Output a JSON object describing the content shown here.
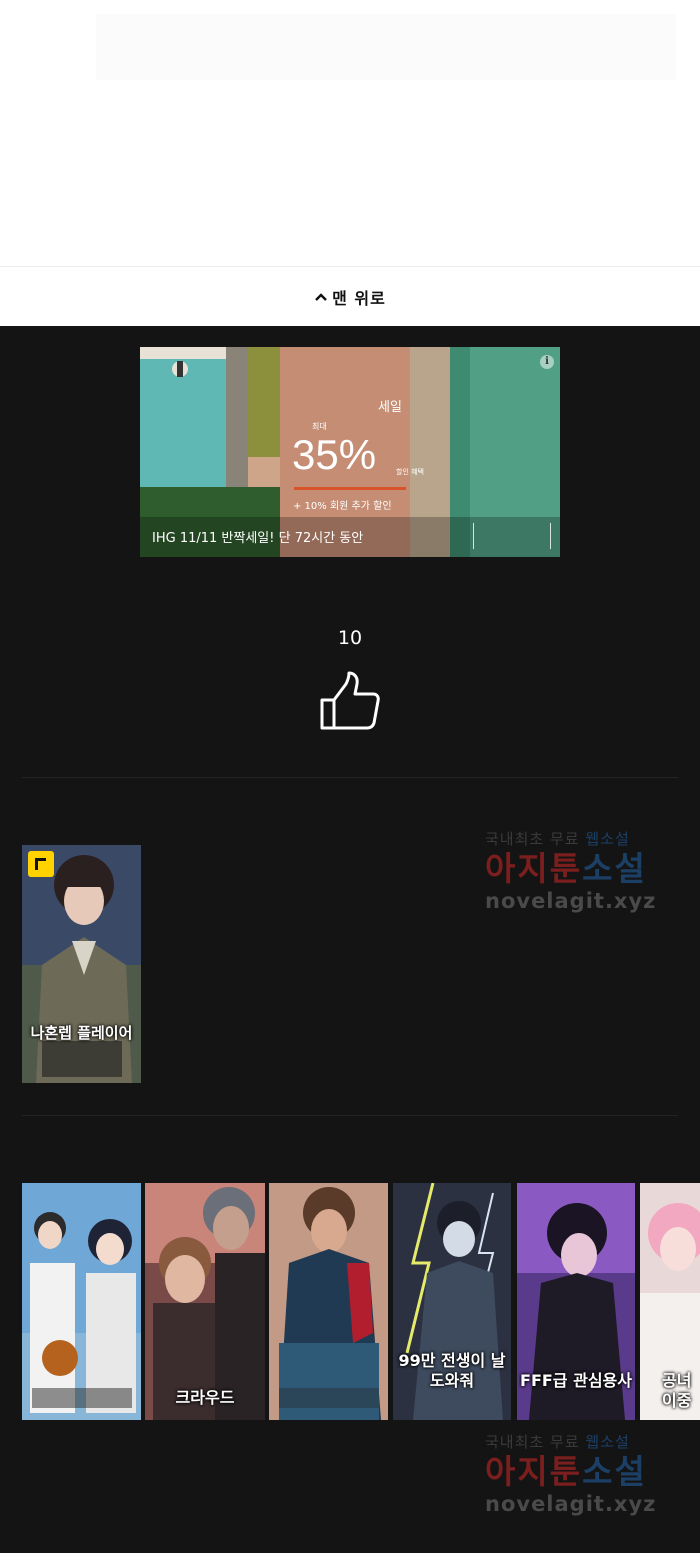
{
  "nav": {
    "back_to_top_label": "맨 위로"
  },
  "ad": {
    "sale_fragment": "세일",
    "max_label": "최대",
    "discount_value": "35%",
    "discount_label": "할인 혜택",
    "extra_label": "+ 10% 회원 추가 할인",
    "caption": "IHG 11/11 반짝세일! 단 72시간 동안",
    "info_icon": "i"
  },
  "likes": {
    "count": "10"
  },
  "watermark": {
    "line1_gray": "국내최초 무료 ",
    "line1_blue": "웹소설",
    "line2_red": "아지툰",
    "line2_blue": "소설",
    "line3": "novelagit.xyz"
  },
  "featured": {
    "title": "나혼렙 플레이어"
  },
  "recommendations": [
    {
      "title": ""
    },
    {
      "title": "크라우드"
    },
    {
      "title": ""
    },
    {
      "title": "99만 전생이 날 도와줘"
    },
    {
      "title": "FFF급 관심용사"
    },
    {
      "title": "공녀 이중"
    }
  ],
  "colors": {
    "background": "#141414",
    "watermark_red": "#7b1e1e",
    "watermark_blue": "#1c3f66",
    "badge": "#ffd200"
  }
}
